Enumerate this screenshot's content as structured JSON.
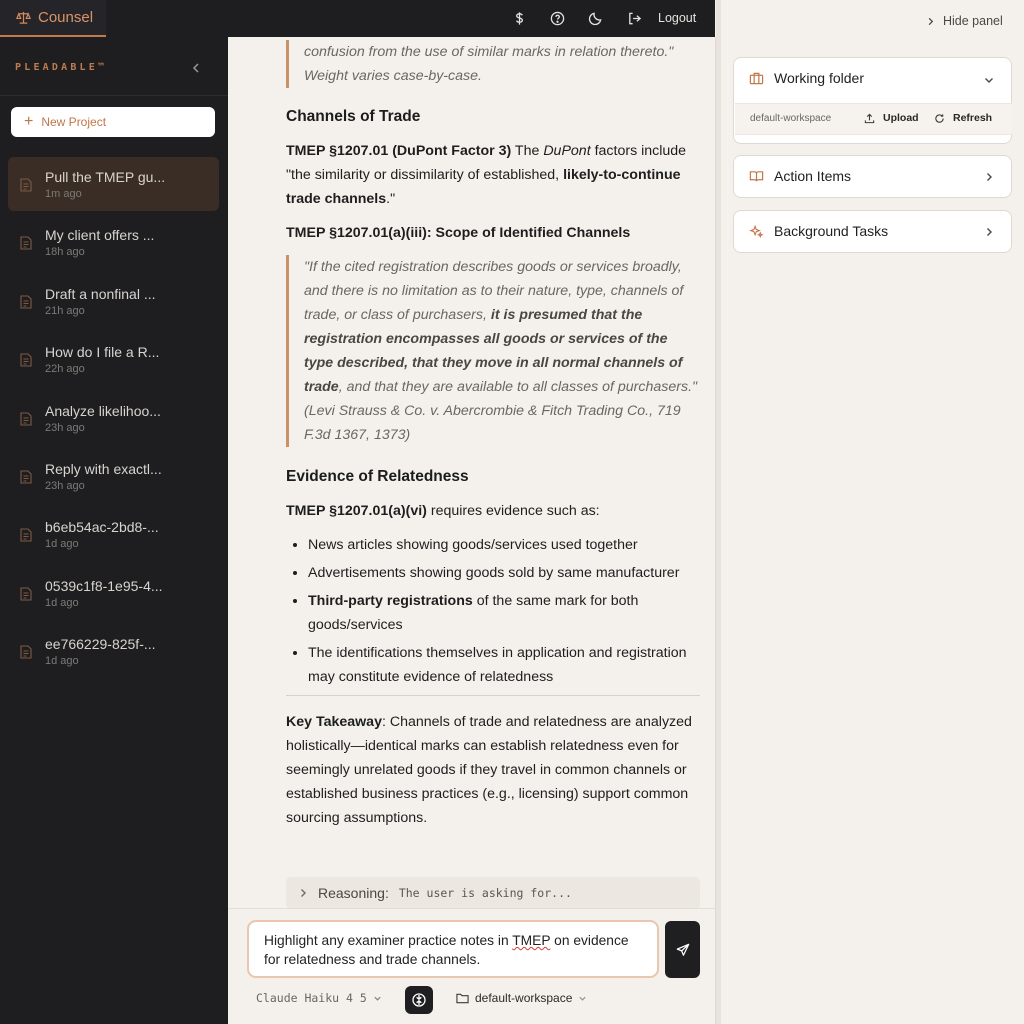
{
  "app": {
    "tab_label": "Counsel",
    "brand": "PLEADABLE™"
  },
  "sidebar": {
    "new_project_label": "New Project",
    "projects": [
      {
        "title": "Pull the TMEP gu...",
        "time": "1m ago"
      },
      {
        "title": "My client offers ...",
        "time": "18h ago"
      },
      {
        "title": "Draft a nonfinal ...",
        "time": "21h ago"
      },
      {
        "title": "How do I file a R...",
        "time": "22h ago"
      },
      {
        "title": "Analyze likelihoo...",
        "time": "23h ago"
      },
      {
        "title": "Reply with exactl...",
        "time": "23h ago"
      },
      {
        "title": "b6eb54ac-2bd8-...",
        "time": "1d ago"
      },
      {
        "title": "0539c1f8-1e95-4...",
        "time": "1d ago"
      },
      {
        "title": "ee766229-825f-...",
        "time": "1d ago"
      }
    ]
  },
  "topbar": {
    "logout_label": "Logout"
  },
  "message": {
    "quote_top": "confusion from the use of similar marks in relation thereto.\" Weight varies case-by-case.",
    "h_channels": "Channels of Trade",
    "p1_ref": "TMEP §1207.01 (DuPont Factor 3)",
    "p1_a": " The ",
    "p1_em": "DuPont",
    "p1_b": " factors include \"the similarity or dissimilarity of established, ",
    "p1_strong": "likely-to-continue trade channels",
    "p1_c": ".\"",
    "p2_ref": "TMEP §1207.01(a)(iii): Scope of Identified Channels",
    "quote2_a": "\"If the cited registration describes goods or services broadly, and there is no limitation as to their nature, type, channels of trade, or class of purchasers, ",
    "quote2_strong": "it is presumed that the registration encompasses all goods or services of the type described, that they move in all normal channels of trade",
    "quote2_b": ", and that they are available to all classes of purchasers.\" (Levi Strauss & Co. v. Abercrombie & Fitch Trading Co., 719 F.3d 1367, 1373)",
    "h_evidence": "Evidence of Relatedness",
    "p3_ref": "TMEP §1207.01(a)(vi)",
    "p3_rest": " requires evidence such as:",
    "bullets": [
      {
        "strong": "",
        "text": "News articles showing goods/services used together"
      },
      {
        "strong": "",
        "text": "Advertisements showing goods sold by same manufacturer"
      },
      {
        "strong": "Third-party registrations",
        "text": " of the same mark for both goods/services"
      },
      {
        "strong": "",
        "text": "The identifications themselves in application and registration may constitute evidence of relatedness"
      }
    ],
    "takeaway_label": "Key Takeaway",
    "takeaway_text": ": Channels of trade and relatedness are analyzed holistically—identical marks can establish relatedness even for seemingly unrelated goods if they travel in common channels or established business practices (e.g., licensing) support common sourcing assumptions.",
    "reasoning_label": "Reasoning:",
    "reasoning_text": "The user is asking for..."
  },
  "composer": {
    "text_a": "Highlight any examiner practice notes in ",
    "text_spell": "TMEP",
    "text_b": " on evidence for relatedness and trade channels.",
    "model": "Claude Haiku 4 5",
    "workspace": "default-workspace"
  },
  "right_panel": {
    "hide_label": "Hide panel",
    "working_folder": {
      "title": "Working folder",
      "workspace": "default-workspace",
      "upload_label": "Upload",
      "refresh_label": "Refresh"
    },
    "action_items_title": "Action Items",
    "background_tasks_title": "Background Tasks"
  },
  "colors": {
    "accent": "#c17a4e",
    "sidebar_bg": "#1e1e21",
    "main_bg": "#f4f1ec"
  }
}
